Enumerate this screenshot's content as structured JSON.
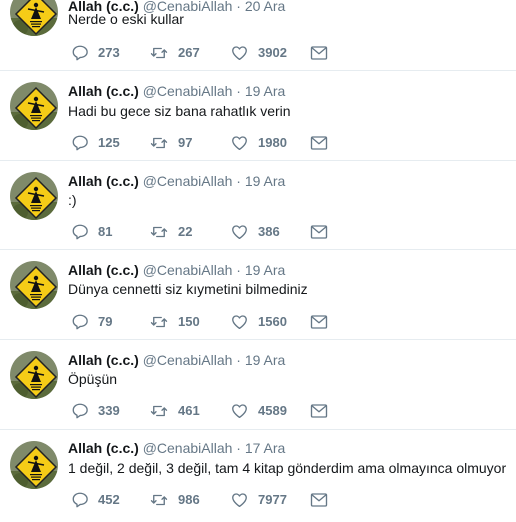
{
  "tweets": [
    {
      "name": "Allah (c.c.)",
      "handle": "@CenabiAllah",
      "separator": "·",
      "date": "20 Ara",
      "text": "Nerde o eski kullar",
      "replies": "273",
      "retweets": "267",
      "likes": "3902"
    },
    {
      "name": "Allah (c.c.)",
      "handle": "@CenabiAllah",
      "separator": "·",
      "date": "19 Ara",
      "text": "Hadi bu gece siz bana rahatlık verin",
      "replies": "125",
      "retweets": "97",
      "likes": "1980"
    },
    {
      "name": "Allah (c.c.)",
      "handle": "@CenabiAllah",
      "separator": "·",
      "date": "19 Ara",
      "text": ":)",
      "replies": "81",
      "retweets": "22",
      "likes": "386"
    },
    {
      "name": "Allah (c.c.)",
      "handle": "@CenabiAllah",
      "separator": "·",
      "date": "19 Ara",
      "text": "Dünya cennetti siz kıymetini bilmediniz",
      "replies": "79",
      "retweets": "150",
      "likes": "1560"
    },
    {
      "name": "Allah (c.c.)",
      "handle": "@CenabiAllah",
      "separator": "·",
      "date": "19 Ara",
      "text": "Öpüşün",
      "replies": "339",
      "retweets": "461",
      "likes": "4589"
    },
    {
      "name": "Allah (c.c.)",
      "handle": "@CenabiAllah",
      "separator": "·",
      "date": "17 Ara",
      "text": "1 değil, 2 değil, 3 değil, tam 4 kitap gönderdim ama olmayınca olmuyor",
      "replies": "452",
      "retweets": "986",
      "likes": "7977"
    }
  ],
  "icons": {
    "reply": "reply-icon",
    "retweet": "retweet-icon",
    "like": "heart-icon",
    "message": "envelope-icon"
  },
  "colors": {
    "text": "#14171a",
    "secondary": "#657786",
    "divider": "#e6ecf0",
    "avatar_sign": "#f5cc17"
  }
}
